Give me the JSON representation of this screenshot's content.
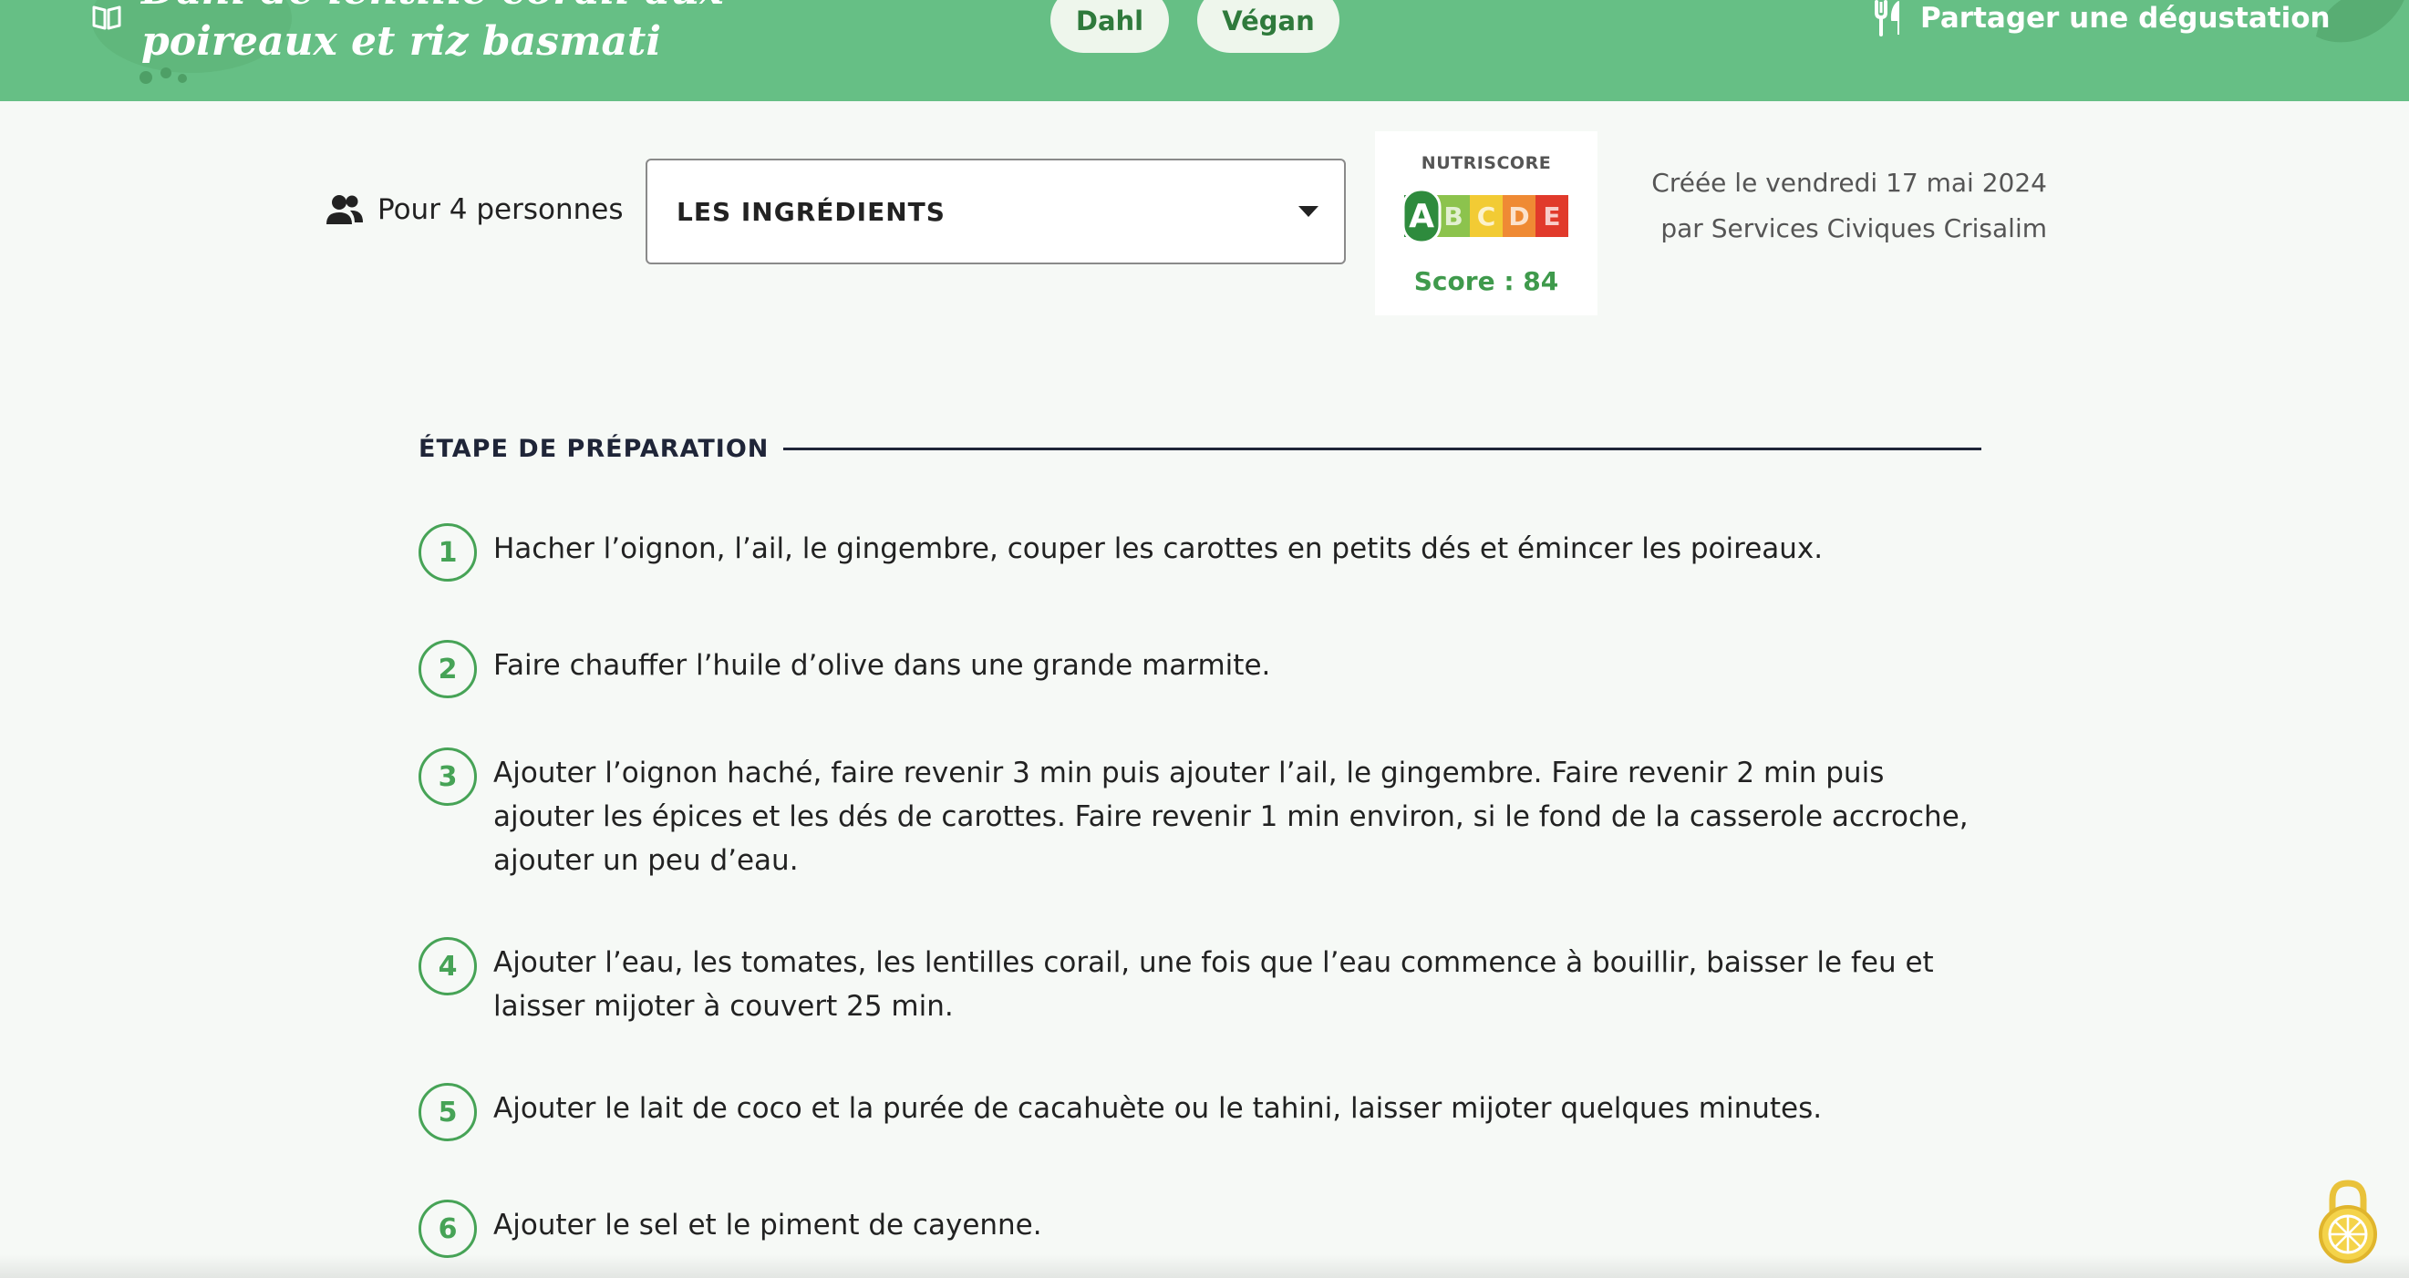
{
  "header": {
    "title": "Dahl de lentille corail aux poireaux et riz basmati",
    "tags": [
      "Dahl",
      "Végan"
    ],
    "share_label": "Partager une dégustation"
  },
  "controls": {
    "servings_label": "Pour 4 personnes",
    "ingredients_select": "LES INGRÉDIENTS"
  },
  "nutriscore": {
    "title": "NUTRISCORE",
    "grades": [
      "A",
      "B",
      "C",
      "D",
      "E"
    ],
    "selected": "A",
    "score_label": "Score : 84",
    "colors": [
      "#2e8b3d",
      "#8cc34d",
      "#f2cb34",
      "#ef8a34",
      "#e13a2b"
    ]
  },
  "meta": {
    "created_line": "Créée le vendredi 17 mai 2024",
    "author_line": "par Services Civiques Crisalim"
  },
  "preparation": {
    "heading": "ÉTAPE DE PRÉPARATION",
    "steps": [
      {
        "num": "1",
        "text": "Hacher l’oignon, l’ail, le gingembre, couper les carottes en petits dés et émincer les poireaux."
      },
      {
        "num": "2",
        "text": "Faire chauffer l’huile d’olive dans une grande marmite."
      },
      {
        "num": "3",
        "text": "Ajouter l’oignon haché, faire revenir 3 min puis ajouter l’ail, le gingembre. Faire revenir 2 min puis ajouter les épices et les dés de carottes. Faire revenir 1 min environ, si le fond de la casserole accroche, ajouter un peu d’eau."
      },
      {
        "num": "4",
        "text": "Ajouter l’eau, les tomates, les lentilles corail, une fois que l’eau commence à bouillir, baisser le feu et laisser mijoter à couvert 25 min."
      },
      {
        "num": "5",
        "text": "Ajouter le lait de coco et la purée de cacahuète ou le tahini, laisser mijoter quelques minutes."
      },
      {
        "num": "6",
        "text": "Ajouter le sel et le piment de cayenne."
      }
    ]
  },
  "theme": {
    "header_green": "#66bf85",
    "accent_green": "#46a356",
    "heading_navy": "#1f2538"
  }
}
